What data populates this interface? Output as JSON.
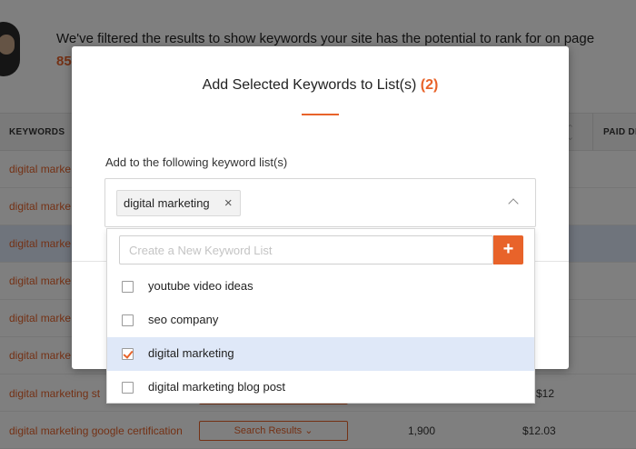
{
  "background": {
    "banner_text": "We've filtered the results to show keywords your site has the potential to rank for on page",
    "banner_number": "85",
    "table": {
      "headers": {
        "keywords": "KEYWORDS",
        "paid": "PAID DI"
      },
      "rows": [
        {
          "keyword": "digital marke",
          "button": "",
          "volume": "",
          "cpc": ""
        },
        {
          "keyword": "digital marke",
          "button": "",
          "volume": "",
          "cpc": ""
        },
        {
          "keyword": "digital marke",
          "button": "",
          "volume": "",
          "cpc": "",
          "highlighted": true
        },
        {
          "keyword": "digital marke",
          "button": "",
          "volume": "",
          "cpc": ""
        },
        {
          "keyword": "digital marke",
          "button": "",
          "volume": "",
          "cpc": ""
        },
        {
          "keyword": "digital marke",
          "button": "",
          "volume": "",
          "cpc": ""
        },
        {
          "keyword": "digital marketing st",
          "button": "",
          "volume": "",
          "cpc": "$12"
        },
        {
          "keyword": "digital marketing google certification",
          "button": "Search Results ⌄",
          "volume": "1,900",
          "cpc": "$12.03"
        }
      ]
    }
  },
  "modal": {
    "title": "Add Selected Keywords to List(s)",
    "count": "(2)",
    "label": "Add to the following keyword list(s)",
    "selected_tags": [
      "digital marketing"
    ],
    "tag_remove_glyph": "×",
    "chevron_icon": "chevron-up-icon"
  },
  "dropdown": {
    "new_list_placeholder": "Create a New Keyword List",
    "new_list_value": "",
    "add_glyph": "+",
    "options": [
      {
        "label": "youtube video ideas",
        "checked": false
      },
      {
        "label": "seo company",
        "checked": false
      },
      {
        "label": "digital marketing",
        "checked": true
      },
      {
        "label": "digital marketing blog post",
        "checked": false
      }
    ]
  },
  "colors": {
    "accent": "#e8632a",
    "selected_row": "#dfe8f8",
    "overlay": "rgba(0,0,0,0.5)"
  }
}
